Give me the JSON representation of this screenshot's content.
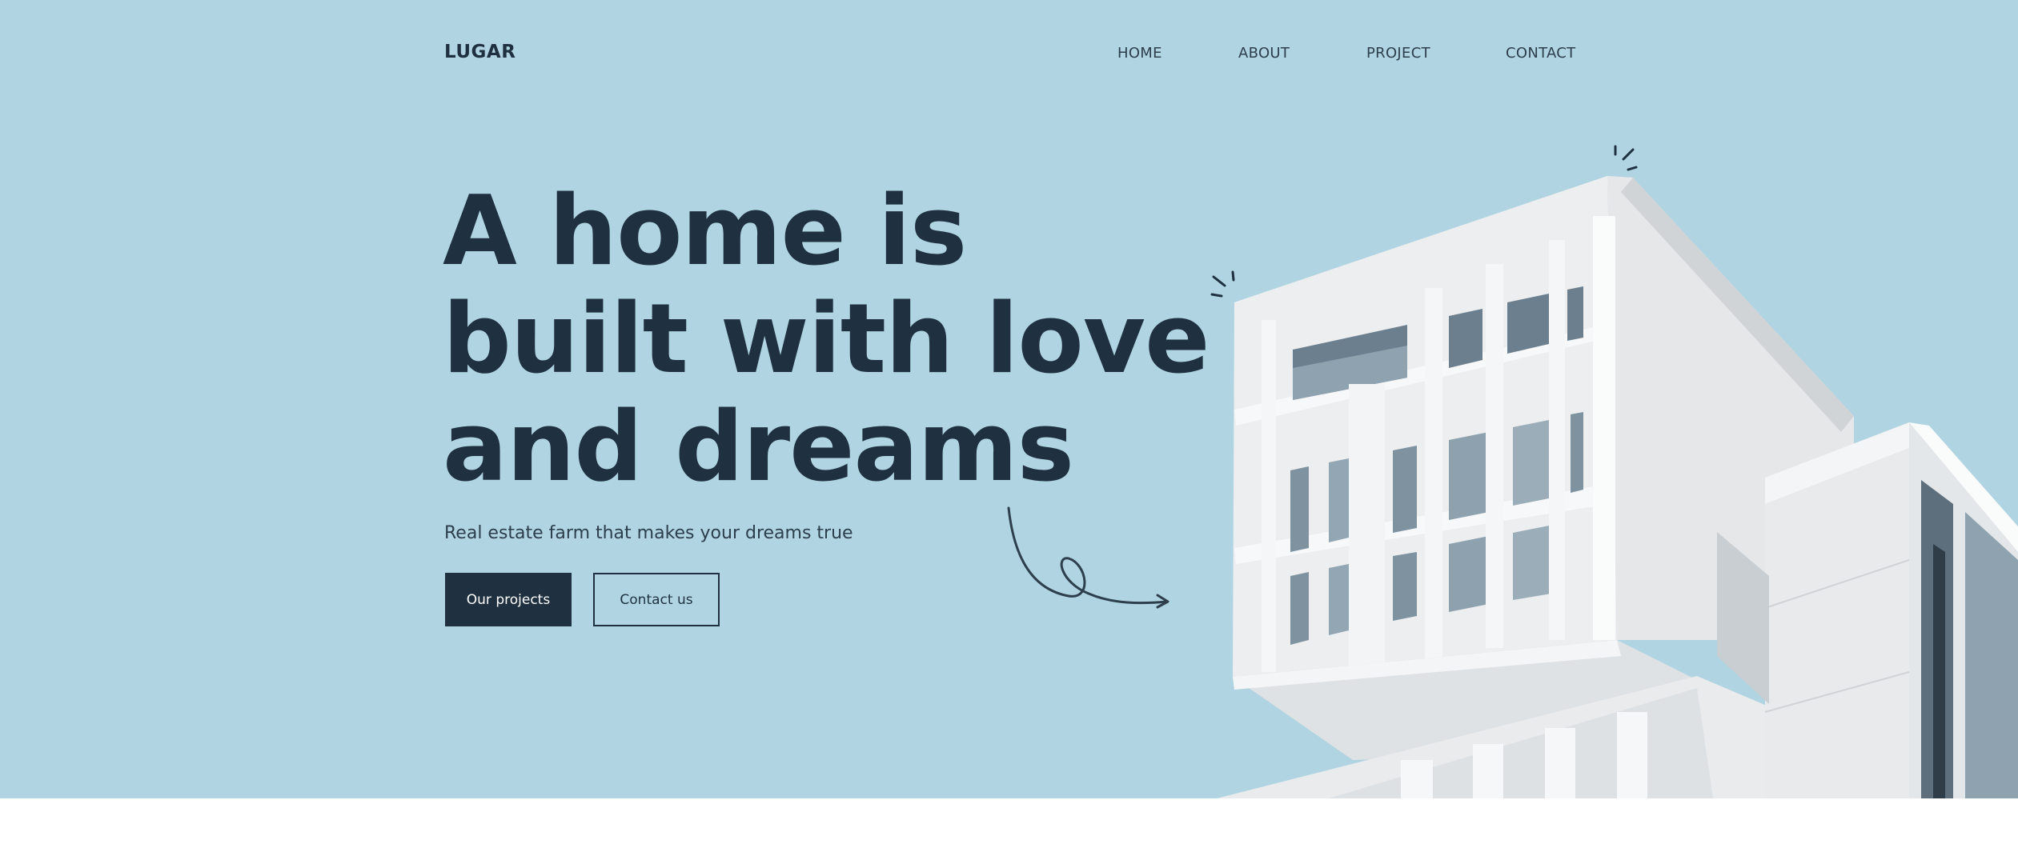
{
  "brand": {
    "logo": "LUGAR"
  },
  "nav": {
    "items": [
      {
        "label": "HOME"
      },
      {
        "label": "ABOUT"
      },
      {
        "label": "PROJECT"
      },
      {
        "label": "CONTACT"
      }
    ]
  },
  "hero": {
    "headline_lines": [
      "A home is",
      "built with love",
      "and dreams"
    ],
    "subtitle": "Real estate farm that makes your dreams true",
    "primary_button": "Our projects",
    "secondary_button": "Contact us"
  },
  "colors": {
    "background": "#b0d4e1",
    "text": "#1f3140",
    "button_dark": "#1f3140",
    "footer": "#ffffff"
  },
  "decorations": [
    "curly-arrow-icon",
    "spark-lines-icon",
    "building-image"
  ]
}
